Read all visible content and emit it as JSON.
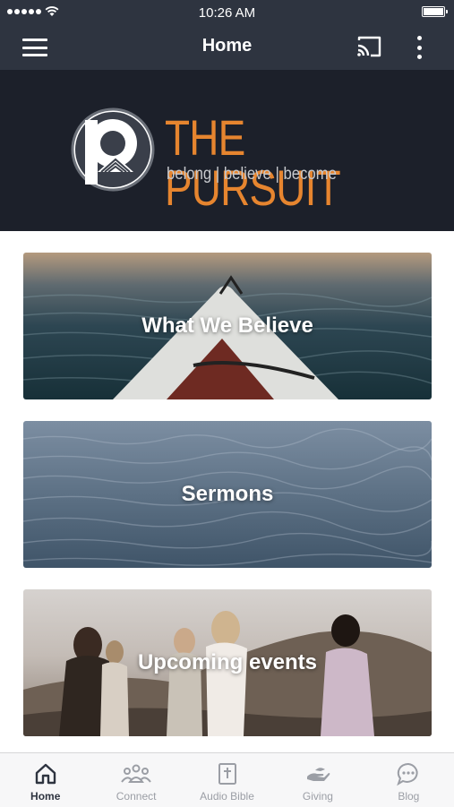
{
  "status_bar": {
    "time": "10:26 AM"
  },
  "app_bar": {
    "title": "Home",
    "menu_icon": "hamburger-menu-icon",
    "cast_icon": "cast-icon",
    "more_icon": "more-vertical-icon"
  },
  "hero": {
    "brand_name": "THE PURSUIT",
    "tagline": "belong | believe | become",
    "brand_color": "#e6852f",
    "background": "#1c202a"
  },
  "cards": [
    {
      "label": "What We Believe"
    },
    {
      "label": "Sermons"
    },
    {
      "label": "Upcoming events"
    }
  ],
  "bottom_nav": {
    "items": [
      {
        "label": "Home",
        "icon": "home-icon",
        "active": true
      },
      {
        "label": "Connect",
        "icon": "people-icon",
        "active": false
      },
      {
        "label": "Audio Bible",
        "icon": "bible-icon",
        "active": false
      },
      {
        "label": "Giving",
        "icon": "giving-hand-icon",
        "active": false
      },
      {
        "label": "Blog",
        "icon": "chat-bubble-icon",
        "active": false
      }
    ]
  },
  "colors": {
    "toolbar": "#2e3440",
    "active_nav": "#2e3440",
    "inactive_nav": "#9b9ea5"
  }
}
